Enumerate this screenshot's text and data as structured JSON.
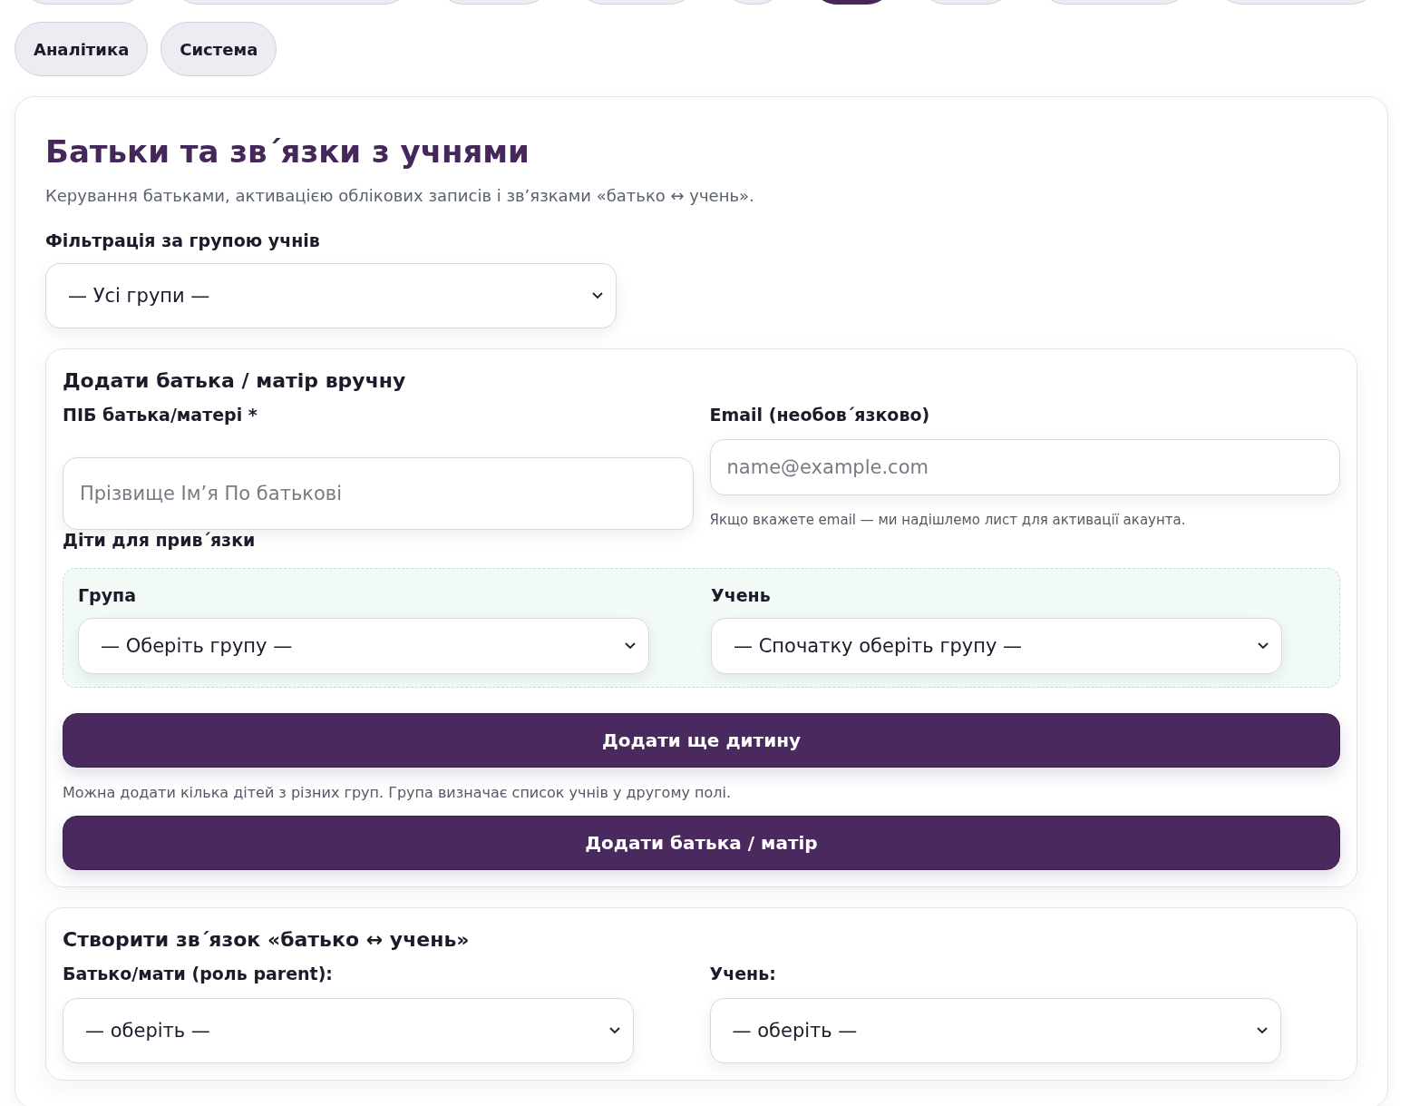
{
  "top_tabs_cut": [
    {
      "selected": false
    },
    {
      "selected": false
    },
    {
      "selected": false
    },
    {
      "selected": false
    },
    {
      "selected": false
    },
    {
      "selected": true
    },
    {
      "selected": false
    },
    {
      "selected": false
    },
    {
      "selected": false
    }
  ],
  "tabs": [
    {
      "label": "Аналітика",
      "selected": false
    },
    {
      "label": "Система",
      "selected": false
    }
  ],
  "page": {
    "title": "Батьки та зв΄язки з учнями",
    "subtitle": "Керування батьками, активацією облікових записів і зв’язками «батько ↔ учень».",
    "filter": {
      "label": "Фільтрація за групою учнів",
      "value": "— Усі групи —"
    }
  },
  "add_parent": {
    "title": "Додати батька / матір вручну",
    "name_field": {
      "label": "ПІБ батька/матері *",
      "placeholder": "Прізвище Ім’я По батькові"
    },
    "email_field": {
      "label": "Email (необов΄язково)",
      "placeholder": "name@example.com",
      "hint": "Якщо вкажете email — ми надішлемо лист для активації акаунта."
    },
    "children_label": "Діти для прив΄язки",
    "group_select": {
      "label": "Група",
      "value": "— Оберіть групу —"
    },
    "student_select": {
      "label": "Учень",
      "value": "— Спочатку оберіть групу —"
    },
    "add_child_button": "Додати ще дитину",
    "note": "Можна додати кілька дітей з різних груп. Група визначає список учнів у другому полі.",
    "submit_button": "Додати батька / матір"
  },
  "link": {
    "title": "Створити зв΄язок «батько ↔ учень»",
    "parent_select": {
      "label": "Батько/мати (роль parent):",
      "value": "— оберіть —"
    },
    "student_select": {
      "label": "Учень:",
      "value": "— оберіть —"
    }
  }
}
